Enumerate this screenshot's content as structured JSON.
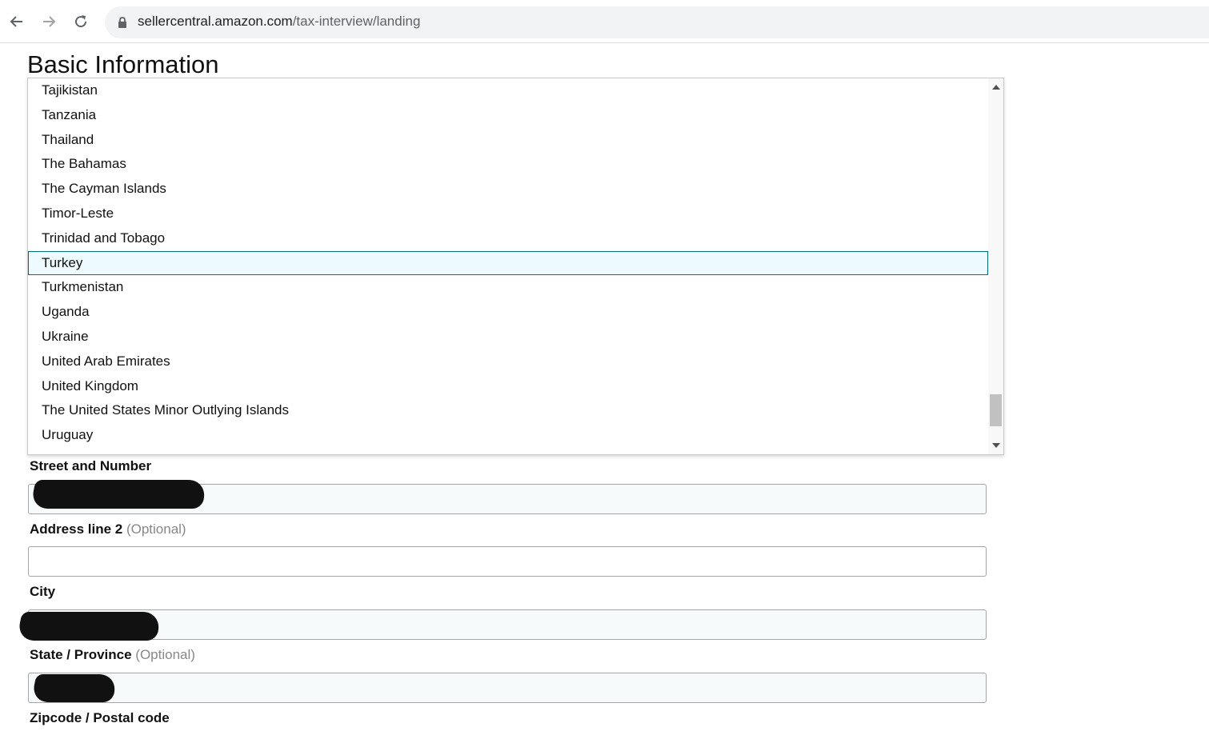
{
  "browser": {
    "url_host": "sellercentral.amazon.com",
    "url_path": "/tax-interview/landing"
  },
  "page": {
    "title": "Basic Information"
  },
  "country_dropdown": {
    "options": [
      "Tajikistan",
      "Tanzania",
      "Thailand",
      "The Bahamas",
      "The Cayman Islands",
      "Timor-Leste",
      "Trinidad and Tobago",
      "Turkey",
      "Turkmenistan",
      "Uganda",
      "Ukraine",
      "United Arab Emirates",
      "United Kingdom",
      "The United States Minor Outlying Islands",
      "Uruguay"
    ],
    "selected": "Turkey"
  },
  "form": {
    "street": {
      "label": "Street and Number",
      "value": ""
    },
    "address2": {
      "label": "Address line 2",
      "optional": "(Optional)",
      "value": ""
    },
    "city": {
      "label": "City",
      "value": ""
    },
    "state": {
      "label": "State / Province",
      "optional": "(Optional)",
      "value": ""
    },
    "zipcode": {
      "label": "Zipcode / Postal code"
    }
  }
}
